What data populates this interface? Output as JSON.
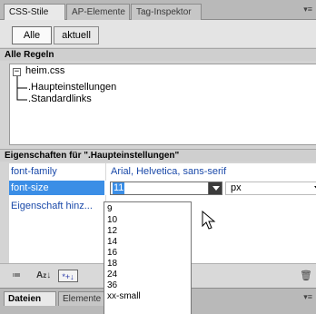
{
  "tabs": [
    {
      "label": "CSS-Stile"
    },
    {
      "label": "AP-Elemente"
    },
    {
      "label": "Tag-Inspektor"
    }
  ],
  "panel_menu_icon": "options-menu-icon",
  "mode_buttons": {
    "all": "Alle",
    "current": "aktuell"
  },
  "rules_section": {
    "title": "Alle Regeln",
    "tree": {
      "root": "heim.css",
      "children": [
        ".Haupteinstellungen",
        ".Standardlinks"
      ]
    }
  },
  "properties_section": {
    "title": "Eigenschaften für \".Haupteinstellungen\"",
    "rows": [
      {
        "name": "font-family",
        "value": "Arial, Helvetica, sans-serif"
      },
      {
        "name": "font-size",
        "value": "11",
        "unit": "px"
      },
      {
        "name": "Eigenschaft hinz...",
        "value": ""
      }
    ]
  },
  "dropdown_options": [
    "9",
    "10",
    "12",
    "14",
    "16",
    "18",
    "24",
    "36",
    "xx-small"
  ],
  "toolbar": {
    "icons": [
      "category-view-icon",
      "alphabetical-view-icon",
      "set-properties-view-icon",
      "trash-icon"
    ],
    "labels": {
      "category": "≔",
      "alpha": "A",
      "alpha_sub": "z",
      "set": "*+↓"
    }
  },
  "bottom_tabs": [
    {
      "label": "Dateien"
    },
    {
      "label": "Elemente"
    }
  ],
  "colors": {
    "selection": "#3b8ee6",
    "property_text": "#1a49a9"
  }
}
